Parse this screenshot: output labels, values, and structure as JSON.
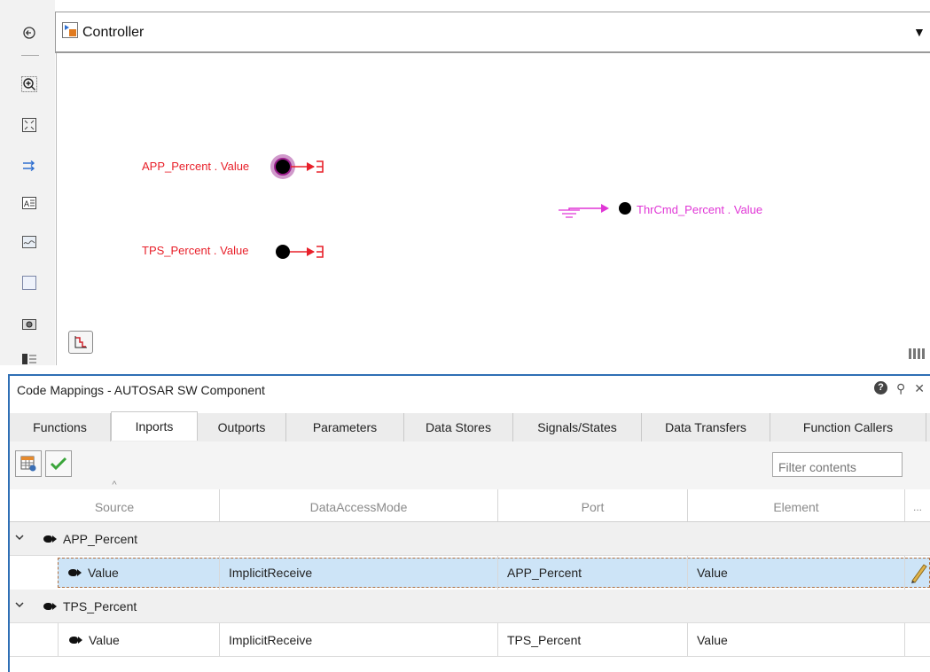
{
  "left_toolbar": {
    "icons": [
      "navigate-back-icon",
      "zoom-in-icon",
      "fit-to-view-icon",
      "signal-lines-icon",
      "annotation-icon",
      "image-icon",
      "area-icon",
      "screenshot-icon",
      "model-browser-icon"
    ]
  },
  "address_bar": {
    "model_name": "Controller",
    "dropdown_glyph": "▼"
  },
  "canvas": {
    "inports": [
      {
        "label": "APP_Percent . Value",
        "selected": true
      },
      {
        "label": "TPS_Percent . Value",
        "selected": false
      }
    ],
    "outports": [
      {
        "label": "ThrCmd_Percent . Value"
      }
    ],
    "colors": {
      "inport": "#e8202a",
      "outport": "#e036d6",
      "selection": "#9b1f8c"
    }
  },
  "panel": {
    "title": "Code Mappings - AUTOSAR SW Component",
    "help_glyph": "?",
    "pin_glyph": "⚲",
    "close_glyph": "✕",
    "tabs": [
      "Functions",
      "Inports",
      "Outports",
      "Parameters",
      "Data Stores",
      "Signals/States",
      "Data Transfers",
      "Function Callers"
    ],
    "active_tab": "Inports",
    "filter_placeholder": "Filter contents",
    "columns": [
      "Source",
      "DataAccessMode",
      "Port",
      "Element",
      "..."
    ],
    "rows": [
      {
        "type": "group",
        "source": "APP_Percent"
      },
      {
        "type": "item",
        "source": "Value",
        "mode": "ImplicitReceive",
        "port": "APP_Percent",
        "element": "Value",
        "selected": true
      },
      {
        "type": "group",
        "source": "TPS_Percent"
      },
      {
        "type": "item",
        "source": "Value",
        "mode": "ImplicitReceive",
        "port": "TPS_Percent",
        "element": "Value",
        "selected": false
      }
    ]
  }
}
